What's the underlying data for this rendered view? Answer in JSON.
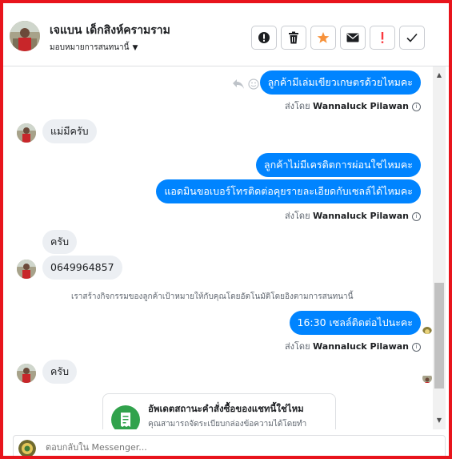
{
  "header": {
    "contact_name": "เจแบน เด็กสิงห์ครามราม",
    "assign_label": "มอบหมายการสนทนานี้",
    "actions": [
      {
        "name": "mark-unread-button",
        "icon": "exclamation-circle-icon"
      },
      {
        "name": "delete-button",
        "icon": "trash-icon"
      },
      {
        "name": "star-button",
        "icon": "star-icon"
      },
      {
        "name": "email-button",
        "icon": "envelope-icon"
      },
      {
        "name": "spam-button",
        "icon": "exclamation-icon"
      },
      {
        "name": "done-button",
        "icon": "checkmark-icon"
      }
    ]
  },
  "messages": {
    "m1": "ลูกค้ามีเล่มเขียวเกษตรด้วยไหมคะ",
    "sent_by_label": "ส่งโดย",
    "sender_name": "Wannaluck Pilawan",
    "m2": "แม่มีครับ",
    "m3": "ลูกค้าไม่มีเครดิตการผ่อนใช่ไหมคะ",
    "m4": "แอดมินขอเบอร์โทรติดต่อคุยรายละเอียดกับเซลล์ได้ไหมคะ",
    "m5": "ครับ",
    "m6": "0649964857",
    "system_note": "เราสร้างกิจกรรมของลูกค้าเป้าหมายให้กับคุณโดยอัตโนมัติโดยอิงตามการสนทนานี้",
    "m7": "16:30 เซลล์ติดต่อไปนะคะ",
    "m8": "ครับ"
  },
  "card": {
    "title": "อัพเดตสถานะคำสั่งซื้อของแชทนี้ใช่ไหม",
    "body": "คุณสามารถจัดระเบียบกล่องข้อความได้โดยทำ"
  },
  "composer": {
    "placeholder": "ตอบกลับใน Messenger..."
  },
  "colors": {
    "outgoing_bubble": "#0084ff",
    "incoming_bubble": "#eceff3",
    "frame_border": "#e8141c",
    "star": "#f7923b",
    "spam": "#fa383e",
    "card_icon": "#31a24c"
  }
}
